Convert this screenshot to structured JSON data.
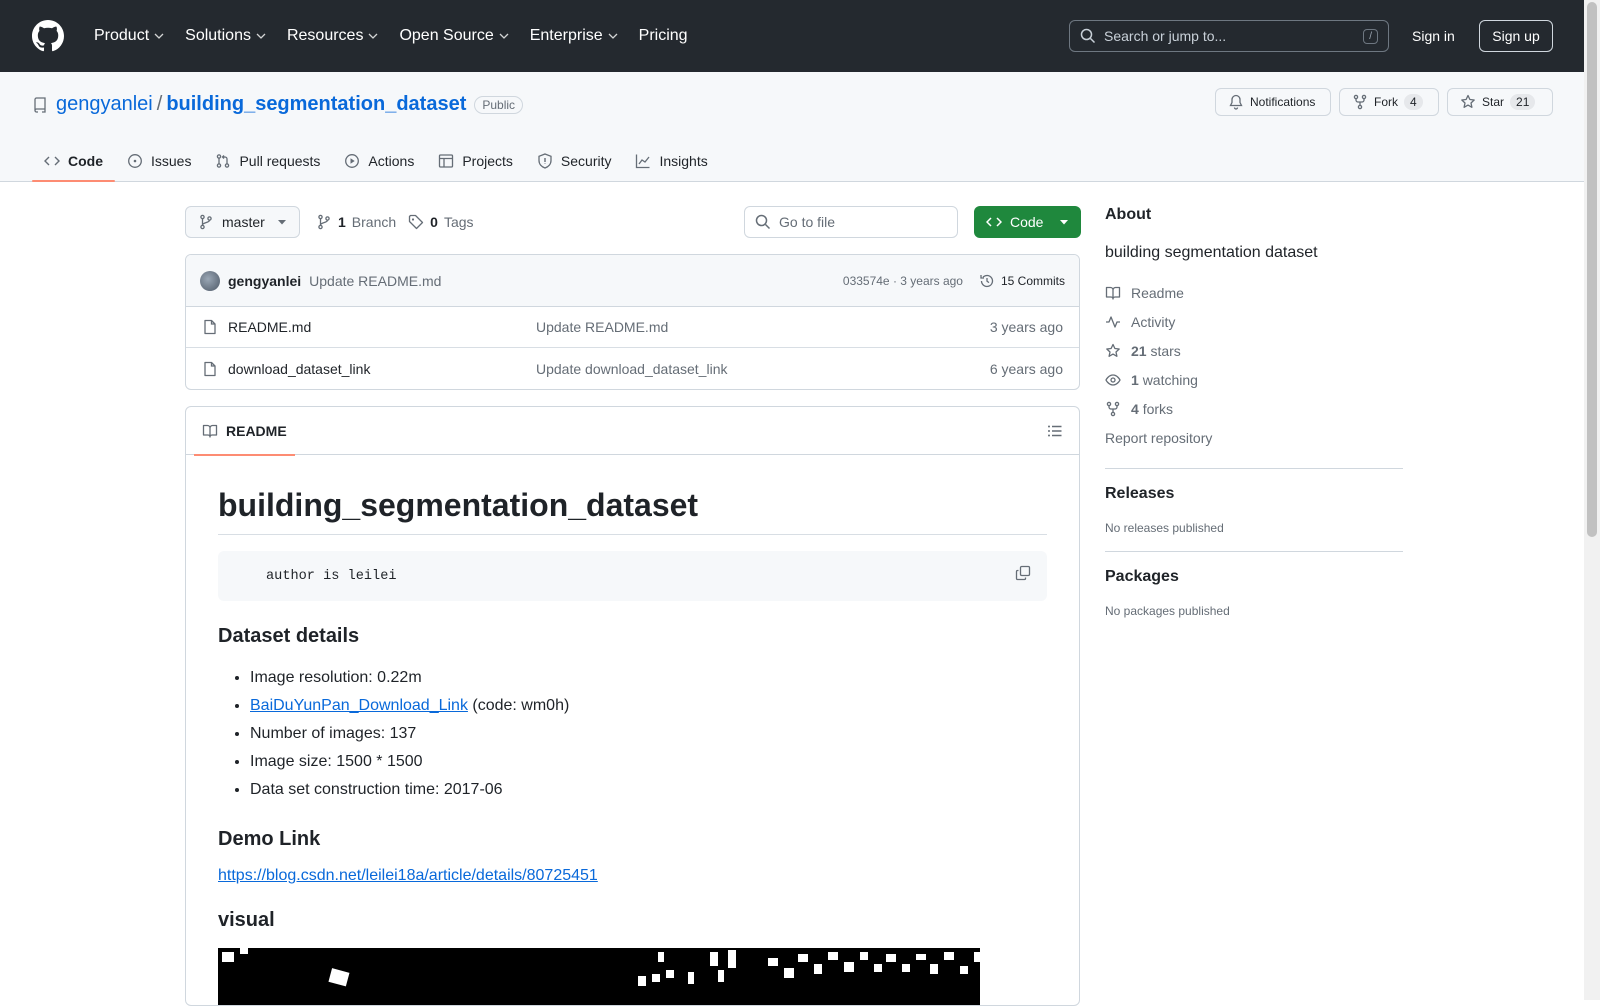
{
  "nav": {
    "items": [
      "Product",
      "Solutions",
      "Resources",
      "Open Source",
      "Enterprise",
      "Pricing"
    ],
    "search_placeholder": "Search or jump to...",
    "search_shortcut": "/",
    "signin": "Sign in",
    "signup": "Sign up"
  },
  "repo": {
    "owner": "gengyanlei",
    "name": "building_segmentation_dataset",
    "visibility": "Public",
    "notifications": "Notifications",
    "fork_label": "Fork",
    "fork_count": "4",
    "star_label": "Star",
    "star_count": "21"
  },
  "tabs": [
    "Code",
    "Issues",
    "Pull requests",
    "Actions",
    "Projects",
    "Security",
    "Insights"
  ],
  "toolbar": {
    "branch": "master",
    "branch_count": "1",
    "branch_label": "Branch",
    "tag_count": "0",
    "tag_label": "Tags",
    "goto_placeholder": "Go to file",
    "code_label": "Code"
  },
  "commit": {
    "author": "gengyanlei",
    "message": "Update README.md",
    "hash_time": "033574e · 3 years ago",
    "count": "15 Commits"
  },
  "files": [
    {
      "name": "README.md",
      "message": "Update README.md",
      "time": "3 years ago"
    },
    {
      "name": "download_dataset_link",
      "message": "Update download_dataset_link",
      "time": "6 years ago"
    }
  ],
  "readme": {
    "tab": "README",
    "title": "building_segmentation_dataset",
    "code": "author is leilei",
    "details_h": "Dataset details",
    "details": {
      "resolution": "Image resolution: 0.22m",
      "link_text": "BaiDuYunPan_Download_Link",
      "link_code": " (code: wm0h)",
      "num": "Number of images: 137",
      "size": "Image size: 1500 * 1500",
      "time": "Data set construction time: 2017-06"
    },
    "demo_h": "Demo Link",
    "demo_url": "https://blog.csdn.net/leilei18a/article/details/80725451",
    "visual_h": "visual"
  },
  "about": {
    "heading": "About",
    "description": "building segmentation dataset",
    "readme": "Readme",
    "activity": "Activity",
    "stars_n": "21",
    "stars": "stars",
    "watching_n": "1",
    "watching": "watching",
    "forks_n": "4",
    "forks": "forks",
    "report": "Report repository",
    "releases_h": "Releases",
    "releases": "No releases published",
    "packages_h": "Packages",
    "packages": "No packages published"
  },
  "colors": {
    "accent": "#0969da",
    "green": "#1f883d",
    "tab_underline": "#fd8c73",
    "header": "#24292f"
  }
}
